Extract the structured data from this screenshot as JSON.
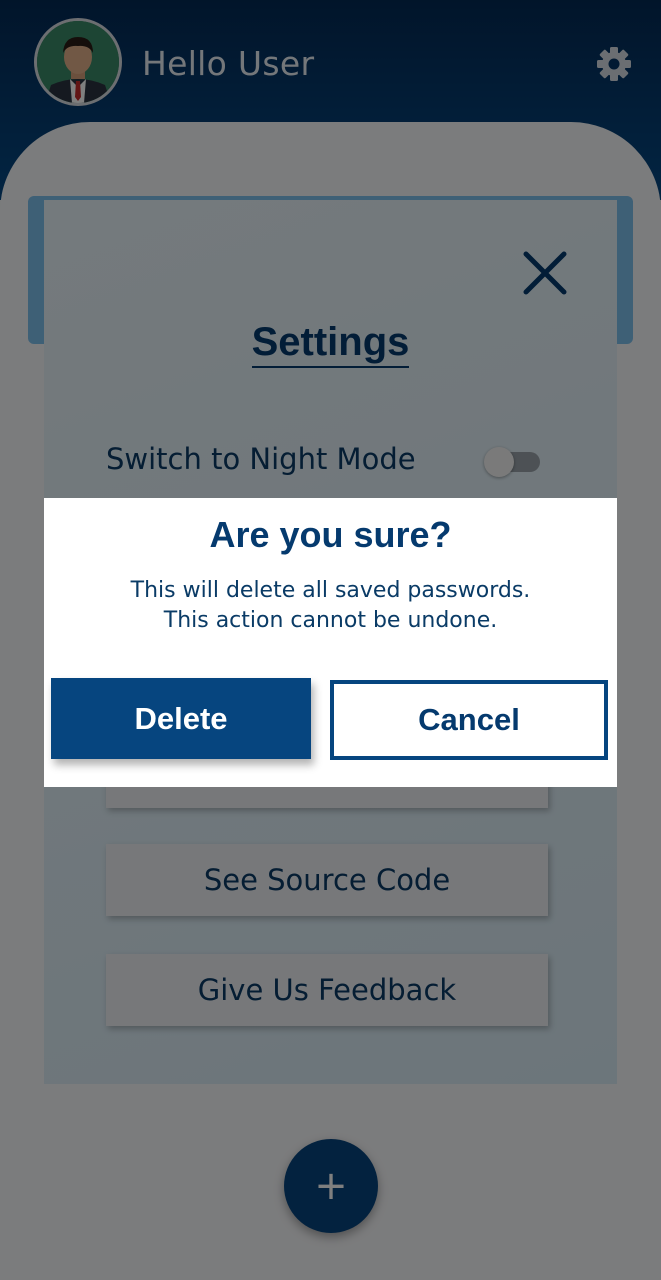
{
  "header": {
    "greeting": "Hello User"
  },
  "settings": {
    "title": "Settings",
    "night_mode_label": "Switch to Night Mode",
    "night_mode_on": false,
    "buttons": {
      "source_code": "See Source Code",
      "feedback": "Give Us Feedback"
    }
  },
  "fab": {
    "label": "+"
  },
  "dialog": {
    "title": "Are you sure?",
    "message_line1": "This will delete all saved passwords.",
    "message_line2": "This action cannot be undone.",
    "delete_label": "Delete",
    "cancel_label": "Cancel"
  },
  "colors": {
    "primary": "#06457f",
    "header_dark": "#032a55",
    "panel_bg": "#e3f1f8",
    "list_card": "#7cc0ec"
  },
  "icons": {
    "settings": "gear-icon",
    "close": "close-icon",
    "avatar": "user-avatar"
  }
}
